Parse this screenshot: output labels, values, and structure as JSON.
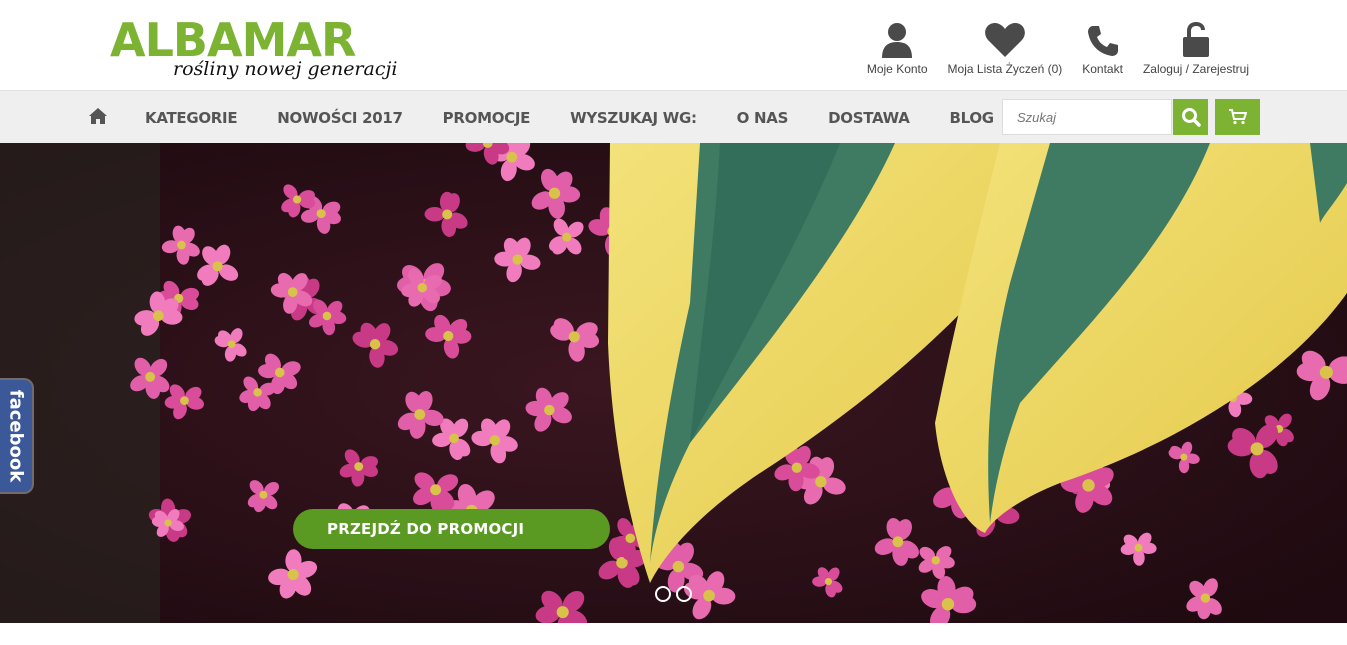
{
  "header": {
    "logo_main": "ALBAMAR",
    "logo_sub": "rośliny nowej generacji",
    "links": [
      {
        "label": "Moje Konto",
        "icon": "user-icon"
      },
      {
        "label": "Moja Lista Życzeń (0)",
        "icon": "heart-icon"
      },
      {
        "label": "Kontakt",
        "icon": "phone-icon"
      },
      {
        "label": "Zaloguj / Zarejestruj",
        "icon": "unlock-icon"
      }
    ]
  },
  "nav": {
    "home_icon": "home-icon",
    "items": [
      "KATEGORIE",
      "NOWOŚCI 2017",
      "PROMOCJE",
      "WYSZUKAJ WG:",
      "O NAS",
      "DOSTAWA",
      "BLOG"
    ],
    "search_placeholder": "Szukaj",
    "search_icon": "search-icon",
    "cart_icon": "cart-icon"
  },
  "hero": {
    "button_label": "PRZEJDŹ DO PROMOCJI",
    "slide_count": 2
  },
  "facebook_tab": "facebook",
  "colors": {
    "brand_green": "#7cb332",
    "button_green": "#5b9a22",
    "facebook_blue": "#3b5998"
  }
}
